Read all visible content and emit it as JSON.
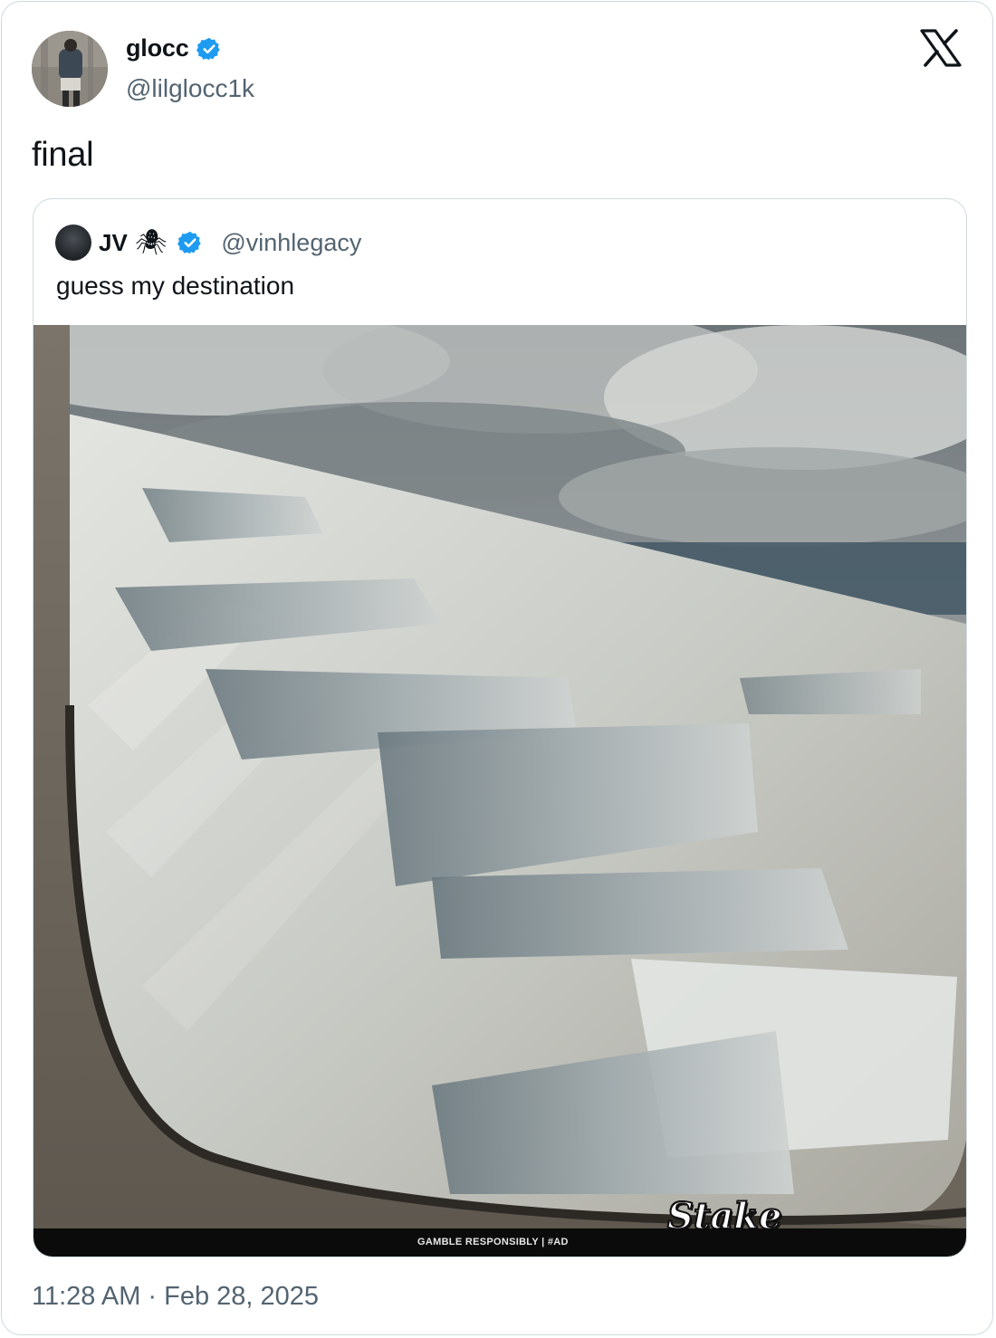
{
  "tweet": {
    "display_name": "glocc",
    "handle": "@lilglocc1k",
    "text": "final",
    "timestamp": "11:28 AM · Feb 28, 2025",
    "platform_icon": "x-logo-icon"
  },
  "quoted_tweet": {
    "display_name": "JV",
    "emoji": "🕷",
    "handle": "@vinhlegacy",
    "text": "guess my destination",
    "image": {
      "description_icon": "photo",
      "ad_text": "GAMBLE RESPONSIBLY | #AD",
      "watermark": "Stake"
    }
  },
  "colors": {
    "verified": "#1d9bf0",
    "secondary_text": "#536471",
    "border": "#cfd9de"
  }
}
